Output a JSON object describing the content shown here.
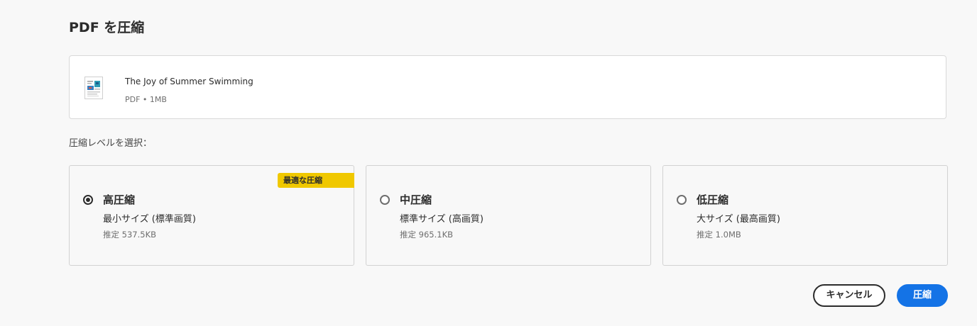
{
  "dialog": {
    "title": "PDF を圧縮"
  },
  "file": {
    "name": "The Joy of Summer Swimming",
    "meta": "PDF • 1MB"
  },
  "section_label": "圧縮レベルを選択：",
  "options": [
    {
      "title": "高圧縮",
      "subtitle": "最小サイズ (標準画質)",
      "estimate": "推定 537.5KB",
      "badge": "最適な圧縮",
      "selected": true
    },
    {
      "title": "中圧縮",
      "subtitle": "標準サイズ (高画質)",
      "estimate": "推定 965.1KB",
      "selected": false
    },
    {
      "title": "低圧縮",
      "subtitle": "大サイズ (最高画質)",
      "estimate": "推定 1.0MB",
      "selected": false
    }
  ],
  "buttons": {
    "cancel_label": "キャンセル",
    "compress_label": "圧縮"
  },
  "colors": {
    "primary": "#1473e6",
    "badge": "#f0c800",
    "background": "#f8f8f8"
  }
}
